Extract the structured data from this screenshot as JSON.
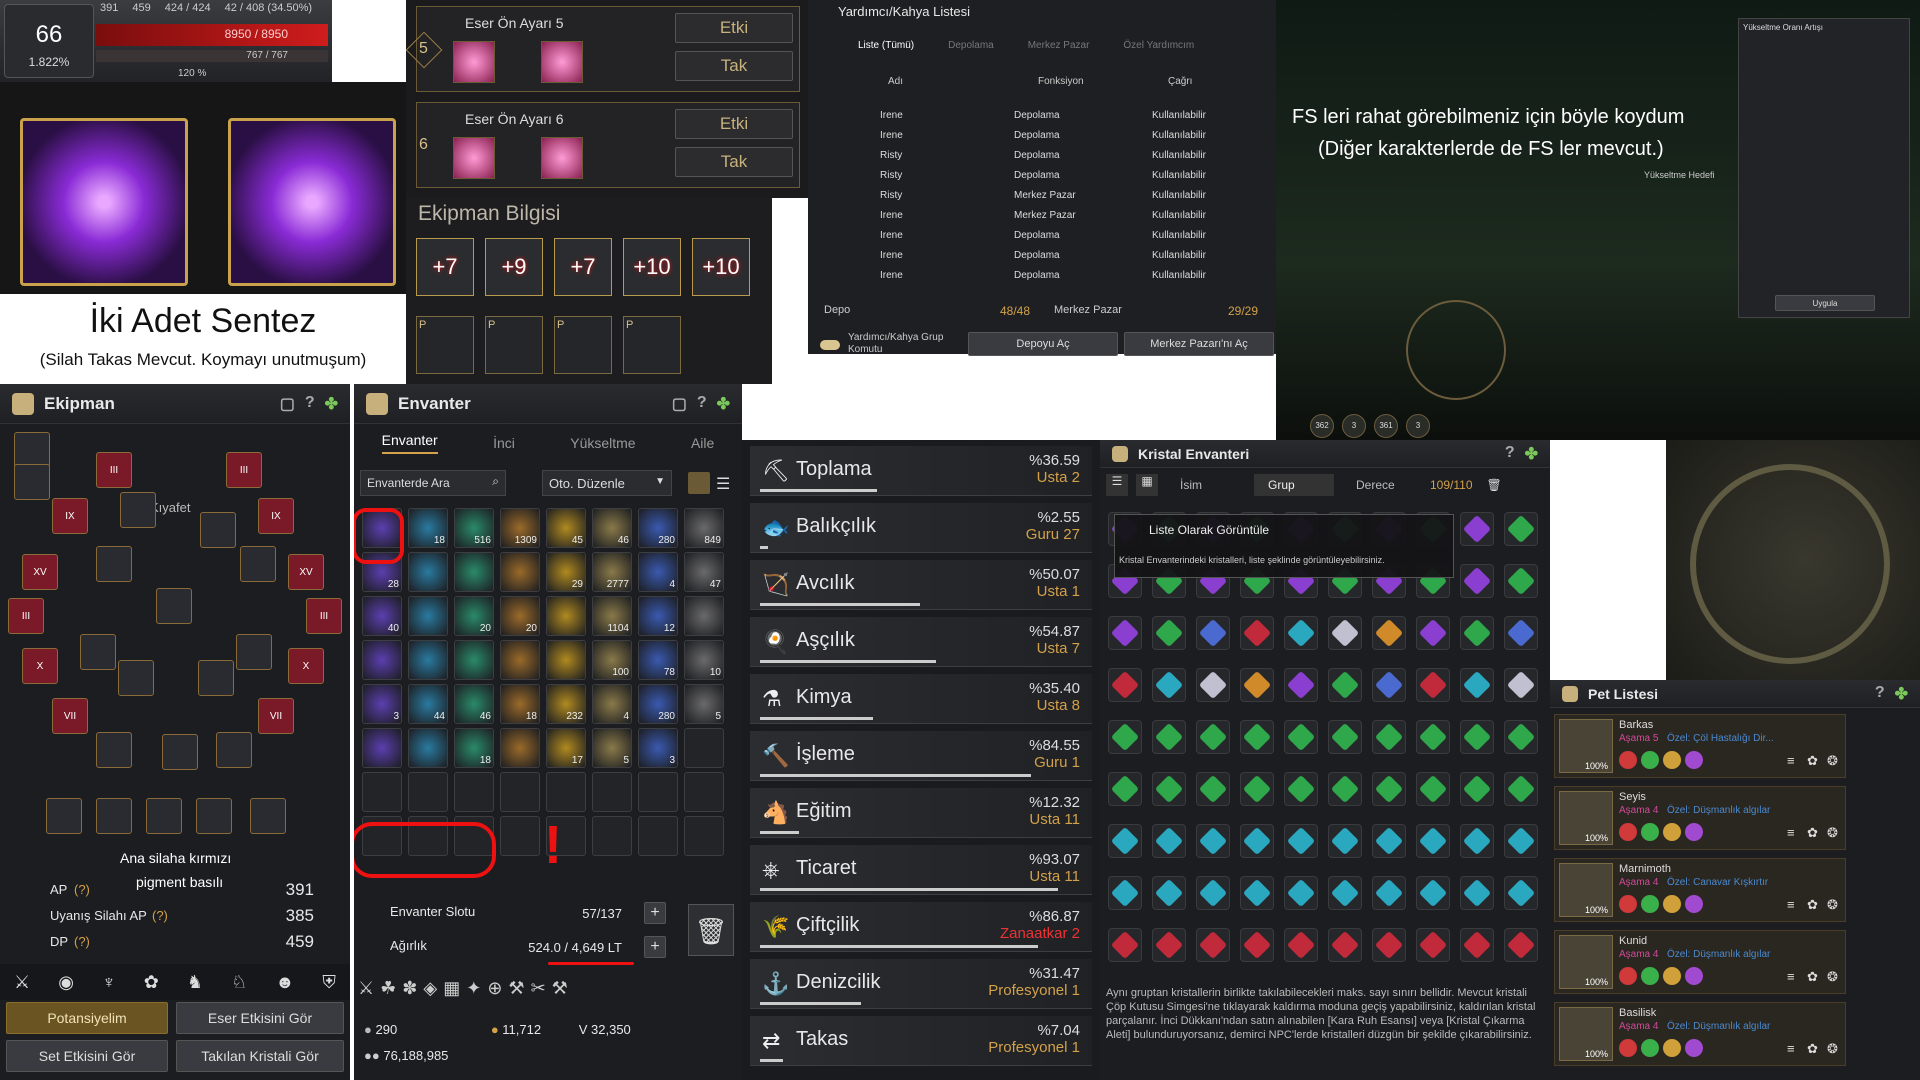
{
  "stats": {
    "level": "66",
    "percent": "1.822%",
    "ap": "391",
    "dp": "459",
    "hp_top": "424 / 424",
    "weight_top": "42 / 408 (34.50%)",
    "hp": "8950 / 8950",
    "mp": "767 / 767",
    "misc": "120 %"
  },
  "sentez": {
    "caption": "İki Adet Sentez",
    "sub": "(Silah Takas Mevcut. Koymayı unutmuşum)"
  },
  "presets": [
    {
      "num": "5",
      "title": "Eser Ön Ayarı 5",
      "btn1": "Etki",
      "btn2": "Tak"
    },
    {
      "num": "6",
      "title": "Eser Ön Ayarı 6",
      "btn1": "Etki",
      "btn2": "Tak"
    }
  ],
  "ekipman_bilgisi": {
    "title": "Ekipman Bilgisi",
    "items": [
      "+7",
      "+9",
      "+7",
      "+10",
      "+10"
    ],
    "p": [
      "P",
      "P",
      "P",
      "P"
    ]
  },
  "helper": {
    "title": "Yardımcı/Kahya Listesi",
    "tabs": [
      "Liste (Tümü)",
      "Depolama",
      "Merkez Pazar",
      "Özel Yardımcım"
    ],
    "headers": [
      "Adı",
      "Fonksiyon",
      "Çağrı"
    ],
    "rows": [
      [
        "Irene",
        "Depolama",
        "Kullanılabilir"
      ],
      [
        "Irene",
        "Depolama",
        "Kullanılabilir"
      ],
      [
        "Risty",
        "Depolama",
        "Kullanılabilir"
      ],
      [
        "Risty",
        "Depolama",
        "Kullanılabilir"
      ],
      [
        "Risty",
        "Merkez Pazar",
        "Kullanılabilir"
      ],
      [
        "Irene",
        "Merkez Pazar",
        "Kullanılabilir"
      ],
      [
        "Irene",
        "Depolama",
        "Kullanılabilir"
      ],
      [
        "Irene",
        "Depolama",
        "Kullanılabilir"
      ],
      [
        "Irene",
        "Depolama",
        "Kullanılabilir"
      ]
    ],
    "depo_label": "Depo",
    "depo_val": "48/48",
    "pazar_label": "Merkez Pazar",
    "pazar_val": "29/29",
    "group_cmd": "Yardımcı/Kahya Grup Komutu",
    "btn1": "Depoyu Aç",
    "btn2": "Merkez Pazarı'nı Aç"
  },
  "fs": {
    "line1": "FS leri rahat görebilmeniz için böyle koydum",
    "line2": "(Diğer karakterlerde de FS ler mevcut.)",
    "panel_title": "Yükseltme Oranı Artışı",
    "apply": "Uygula",
    "evolve": "Yükseltme Hedefi",
    "badges": [
      "362",
      "3",
      "361",
      "3"
    ]
  },
  "ekipman": {
    "title": "Ekipman",
    "kiyafet": "Kıyafet",
    "note1": "Ana silaha kırmızı",
    "note2": "pigment basılı",
    "ap_label": "AP",
    "ap": "391",
    "uap_label": "Uyanış Silahı AP",
    "uap": "385",
    "dp_label": "DP",
    "dp": "459",
    "q": "(?)",
    "btns": [
      "Potansiyelim",
      "Eser Etkisini Gör",
      "Set Etkisini Gör",
      "Takılan Kristali Gör"
    ],
    "roman": [
      "III",
      "III",
      "IX",
      "IX",
      "XV",
      "XV",
      "III",
      "III",
      "X",
      "X",
      "VII",
      "VII"
    ]
  },
  "envanter": {
    "title": "Envanter",
    "tabs": [
      "Envanter",
      "İnci",
      "Yükseltme",
      "Aile"
    ],
    "search": "Envanterde Ara",
    "sort": "Oto. Düzenle",
    "slot_label": "Envanter Slotu",
    "slot_val": "57/137",
    "weight_label": "Ağırlık",
    "weight_val": "524.0 / 4,649 LT",
    "silver_small": "290",
    "coin1": "11,712",
    "coin2": "32,350",
    "silver": "76,188,985",
    "counts": [
      "",
      "18",
      "516",
      "1309",
      "45",
      "46",
      "280",
      "849",
      "28",
      "",
      "",
      "",
      "29",
      "2777",
      "4",
      "47",
      "40",
      "",
      "20",
      "20",
      "",
      "1104",
      "12",
      "",
      "",
      "",
      "",
      "",
      "",
      "100",
      "78",
      "10",
      "3",
      "44",
      "46",
      "18",
      "232",
      "4",
      "280",
      "5",
      "",
      "",
      "18",
      "",
      "17",
      "5",
      "3",
      ""
    ]
  },
  "life": [
    {
      "name": "Toplama",
      "pct": "%36.59",
      "lvl": "Usta 2"
    },
    {
      "name": "Balıkçılık",
      "pct": "%2.55",
      "lvl": "Guru 27"
    },
    {
      "name": "Avcılık",
      "pct": "%50.07",
      "lvl": "Usta 1"
    },
    {
      "name": "Aşçılık",
      "pct": "%54.87",
      "lvl": "Usta 7"
    },
    {
      "name": "Kimya",
      "pct": "%35.40",
      "lvl": "Usta 8"
    },
    {
      "name": "İşleme",
      "pct": "%84.55",
      "lvl": "Guru 1"
    },
    {
      "name": "Eğitim",
      "pct": "%12.32",
      "lvl": "Usta 11"
    },
    {
      "name": "Ticaret",
      "pct": "%93.07",
      "lvl": "Usta 11"
    },
    {
      "name": "Çiftçilik",
      "pct": "%86.87",
      "lvl": "Zanaatkar 2"
    },
    {
      "name": "Denizcilik",
      "pct": "%31.47",
      "lvl": "Profesyonel 1"
    },
    {
      "name": "Takas",
      "pct": "%7.04",
      "lvl": "Profesyonel 1"
    }
  ],
  "life_icons": [
    "⛏",
    "🐟",
    "🏹",
    "🍳",
    "⚗",
    "🔨",
    "🐴",
    "⎈",
    "🌾",
    "⚓",
    "⇄"
  ],
  "kristal": {
    "title": "Kristal Envanteri",
    "opt1": "İsim",
    "opt2": "Grup",
    "opt3": "Derece",
    "count": "109/110",
    "tooltip_title": "Liste Olarak Görüntüle",
    "tooltip": "Kristal Envanterindeki kristalleri, liste şeklinde görüntüleyebilirsiniz.",
    "help": "Aynı gruptan kristallerin birlikte takılabilecekleri maks. sayı sınırı bellidir. Mevcut kristali Çöp Kutusu Simgesi'ne tıklayarak kaldırma moduna geçiş yapabilirsiniz, kaldırılan kristal parçalanır. İnci Dükkanı'ndan satın alınabilen [Kara Ruh Esansı] veya [Kristal Çıkarma Aleti] bulunduruyorsanız, demirci NPC'lerde kristalleri düzgün bir şekilde çıkarabilirsiniz."
  },
  "pets": {
    "title": "Pet Listesi",
    "items": [
      {
        "name": "Barkas",
        "stage": "Aşama 5",
        "trait": "Özel: Çöl Hastalığı Dir...",
        "pct": "100%"
      },
      {
        "name": "Seyis",
        "stage": "Aşama 4",
        "trait": "Özel: Düşmanlık algılar",
        "pct": "100%"
      },
      {
        "name": "Marnimoth",
        "stage": "Aşama 4",
        "trait": "Özel: Canavar Kışkırtır",
        "pct": "100%"
      },
      {
        "name": "Kunid",
        "stage": "Aşama 4",
        "trait": "Özel: Düşmanlık algılar",
        "pct": "100%"
      },
      {
        "name": "Basilisk",
        "stage": "Aşama 4",
        "trait": "Özel: Düşmanlık algılar",
        "pct": "100%"
      }
    ]
  },
  "colors": {
    "gold": "#d2a14a",
    "red_marker": "#e11",
    "purple": "#8a3fd1",
    "green": "#2ea84a"
  }
}
